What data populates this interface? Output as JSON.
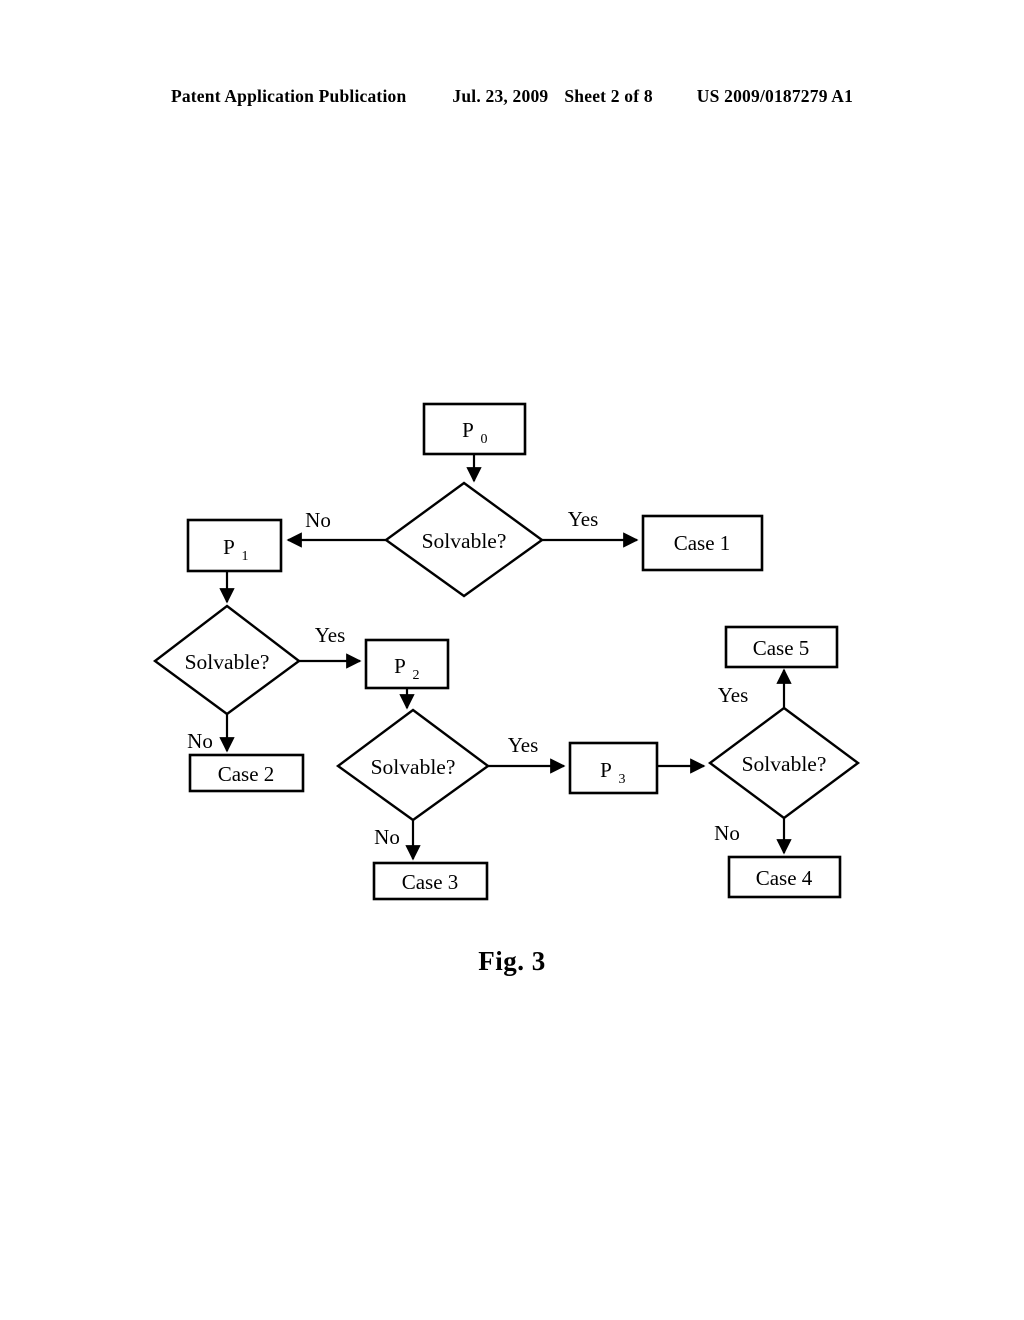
{
  "header": {
    "publication_label": "Patent Application Publication",
    "date": "Jul. 23, 2009",
    "sheet": "Sheet 2 of 8",
    "patent_number": "US 2009/0187279 A1"
  },
  "figure": {
    "caption": "Fig. 3",
    "nodes": {
      "p0": {
        "label": "P",
        "subscript": "0"
      },
      "p1": {
        "label": "P",
        "subscript": "1"
      },
      "p2": {
        "label": "P",
        "subscript": "2"
      },
      "p3": {
        "label": "P",
        "subscript": "3"
      },
      "decision1": {
        "label": "Solvable?"
      },
      "decision2": {
        "label": "Solvable?"
      },
      "decision3": {
        "label": "Solvable?"
      },
      "decision4": {
        "label": "Solvable?"
      },
      "case1": {
        "label": "Case 1"
      },
      "case2": {
        "label": "Case 2"
      },
      "case3": {
        "label": "Case 3"
      },
      "case4": {
        "label": "Case 4"
      },
      "case5": {
        "label": "Case 5"
      }
    },
    "edge_labels": {
      "d1_no": "No",
      "d1_yes": "Yes",
      "d2_yes": "Yes",
      "d2_no": "No",
      "d3_yes": "Yes",
      "d3_no": "No",
      "d4_yes": "Yes",
      "d4_no": "No"
    },
    "colors": {
      "stroke": "#000000",
      "fill": "#ffffff",
      "page_background": "#ffffff"
    }
  }
}
